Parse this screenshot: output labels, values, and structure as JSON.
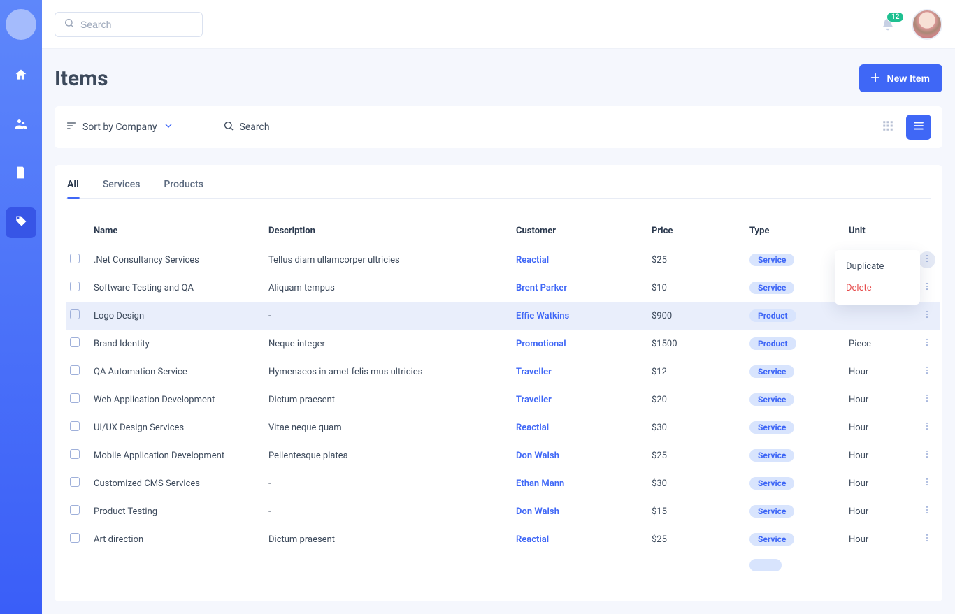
{
  "topbar": {
    "search_placeholder": "Search",
    "notification_count": "12"
  },
  "page": {
    "title": "Items",
    "new_item_label": "New Item"
  },
  "filterbar": {
    "sort_label": "Sort by Company",
    "search_label": "Search"
  },
  "tabs": [
    {
      "label": "All",
      "active": true
    },
    {
      "label": "Services",
      "active": false
    },
    {
      "label": "Products",
      "active": false
    }
  ],
  "columns": {
    "name": "Name",
    "description": "Description",
    "customer": "Customer",
    "price": "Price",
    "type": "Type",
    "unit": "Unit"
  },
  "rows": [
    {
      "name": ".Net Consultancy Services",
      "description": "Tellus diam ullamcorper ultricies",
      "customer": "Reactial",
      "price": "$25",
      "type": "Service",
      "unit": "",
      "action_open": true
    },
    {
      "name": "Software Testing and QA",
      "description": "Aliquam tempus",
      "customer": "Brent Parker",
      "price": "$10",
      "type": "Service",
      "unit": ""
    },
    {
      "name": "Logo Design",
      "description": "-",
      "customer": "Effie Watkins",
      "price": "$900",
      "type": "Product",
      "unit": "",
      "hovered": true
    },
    {
      "name": "Brand Identity",
      "description": "Neque integer",
      "customer": "Promotional",
      "price": "$1500",
      "type": "Product",
      "unit": "Piece"
    },
    {
      "name": "QA Automation Service",
      "description": "Hymenaeos in amet felis mus ultricies",
      "customer": "Traveller",
      "price": "$12",
      "type": "Service",
      "unit": "Hour"
    },
    {
      "name": "Web Application Development",
      "description": "Dictum praesent",
      "customer": "Traveller",
      "price": "$20",
      "type": "Service",
      "unit": "Hour"
    },
    {
      "name": "UI/UX Design Services",
      "description": "Vitae neque quam",
      "customer": "Reactial",
      "price": "$30",
      "type": "Service",
      "unit": "Hour"
    },
    {
      "name": "Mobile Application Development",
      "description": "Pellentesque platea",
      "customer": "Don Walsh",
      "price": "$25",
      "type": "Service",
      "unit": "Hour"
    },
    {
      "name": "Customized CMS Services",
      "description": "-",
      "customer": "Ethan Mann",
      "price": "$30",
      "type": "Service",
      "unit": "Hour"
    },
    {
      "name": "Product Testing",
      "description": "-",
      "customer": "Don Walsh",
      "price": "$15",
      "type": "Service",
      "unit": "Hour"
    },
    {
      "name": "Art direction",
      "description": "Dictum praesent",
      "customer": "Reactial",
      "price": "$25",
      "type": "Service",
      "unit": "Hour"
    },
    {
      "name": "",
      "description": "",
      "customer": "",
      "price": "",
      "type": "",
      "unit": "",
      "empty_badge": true,
      "no_checkbox": true,
      "no_action": true
    }
  ],
  "row_menu": {
    "duplicate": "Duplicate",
    "delete": "Delete"
  }
}
